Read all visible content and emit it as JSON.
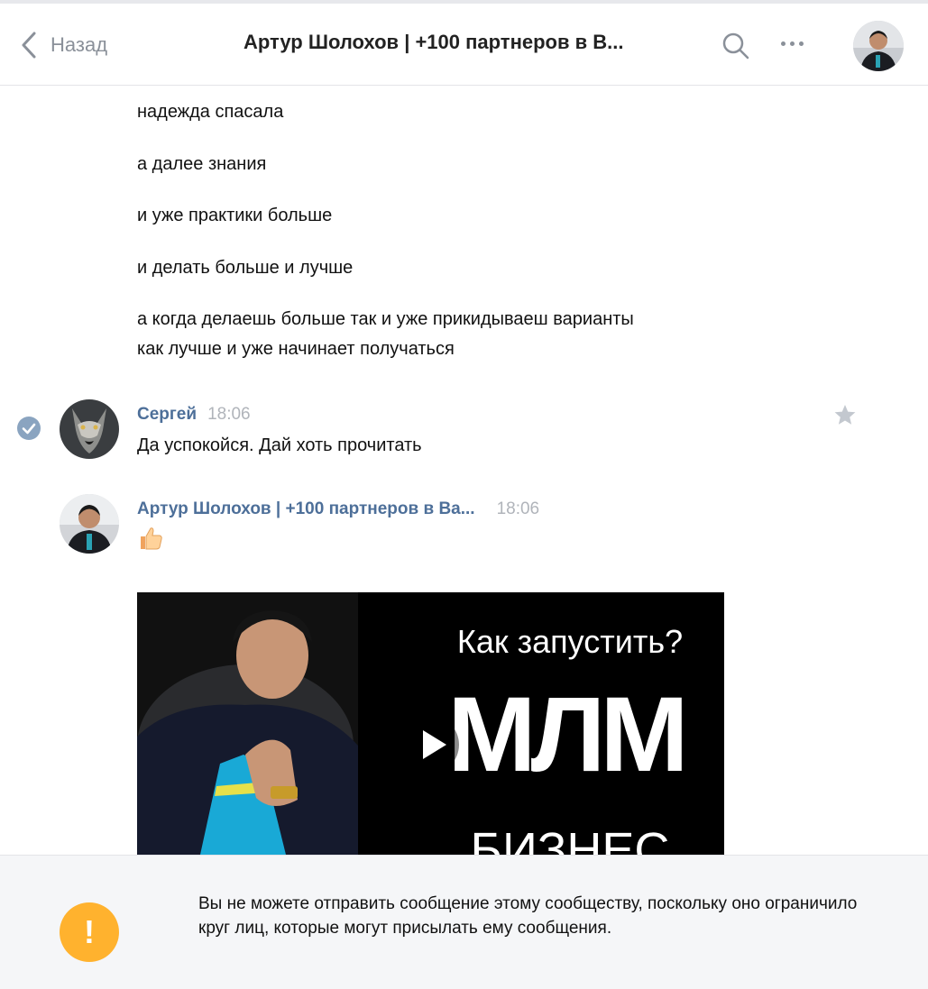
{
  "header": {
    "back_label": "Назад",
    "title": "Артур Шолохов | +100 партнеров в В..."
  },
  "message_lines": [
    "надежда спасала",
    "а далее знания",
    "и уже практики больше",
    "и делать больше и лучше",
    "а когда делаешь больше так и уже прикидываеш варианты",
    "как лучше и уже начинает получаться"
  ],
  "messages": [
    {
      "author": "Сергей",
      "time": "18:06",
      "text": "Да успокойся. Дай хоть прочитать"
    },
    {
      "author": "Артур Шолохов | +100 партнеров в Ва...",
      "time": "18:06",
      "text": "",
      "attachment": {
        "title": "Как запустить?",
        "big_text": "МЛМ",
        "sub_text": "БИЗНЕС"
      }
    }
  ],
  "notice": {
    "text": "Вы не можете отправить сообщение этому сообществу, поскольку оно ограничило круг лиц, которые могут присылать ему сообщения.",
    "icon_symbol": "!"
  },
  "colors": {
    "accent_link": "#4d6f99",
    "warning": "#ffb22e",
    "secondary_text": "#8a9099"
  }
}
